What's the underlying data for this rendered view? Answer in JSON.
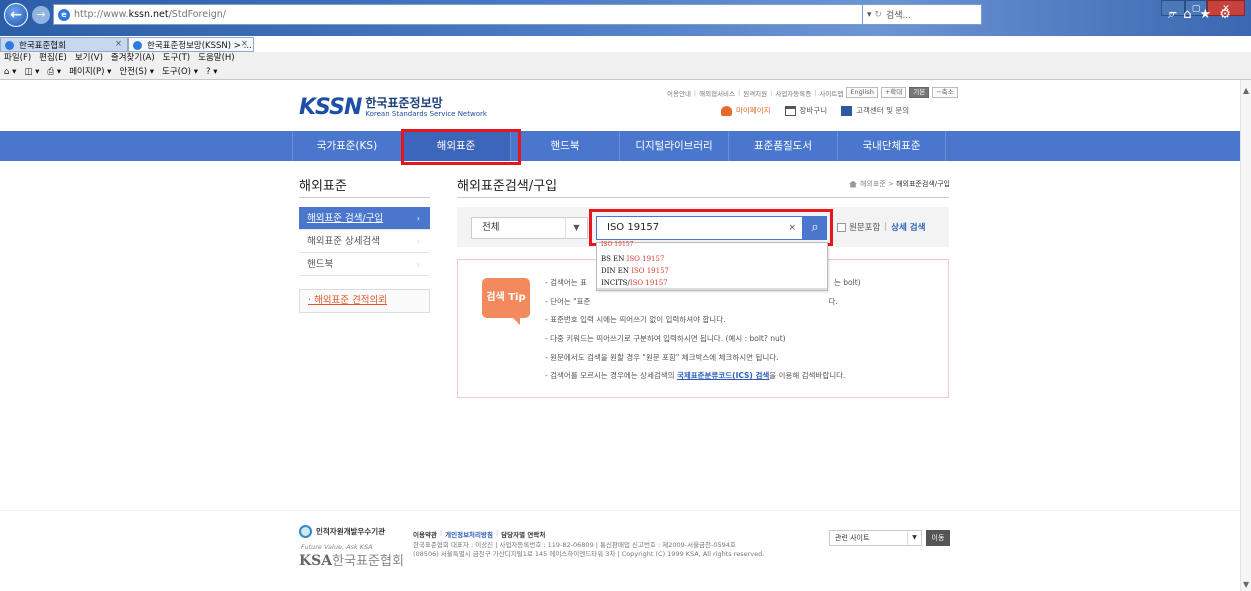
{
  "browser": {
    "url_prefix": "http://www.",
    "url_domain": "kssn.net",
    "url_path": "/StdForeign/",
    "search_placeholder": "검색...",
    "tabs": [
      {
        "title": "한국표준협회"
      },
      {
        "title": "한국표준정보망(KSSN) > ..."
      }
    ],
    "menu": [
      "파일(F)",
      "편집(E)",
      "보기(V)",
      "즐겨찾기(A)",
      "도구(T)",
      "도움말(H)"
    ],
    "commands": [
      "▾",
      "▾",
      "▾",
      "페이지(P) ▾",
      "안전(S) ▾",
      "도구(O) ▾",
      "▾"
    ]
  },
  "site": {
    "logo_mark": "KSSN",
    "logo_ko": "한국표준정보망",
    "logo_en": "Korean Standards Service Network",
    "util_links": [
      "이용안내",
      "해외협서비스",
      "원격지원",
      "사업자등록증",
      "사이트맵"
    ],
    "util_buttons": [
      "English",
      "+확대",
      "기본",
      "−축소"
    ],
    "user_links": {
      "mypage": "마이페이지",
      "cart": "장바구니",
      "support": "고객센터 및 문의"
    },
    "gnb": [
      "국가표준(KS)",
      "해외표준",
      "핸드북",
      "디지털라이브러리",
      "표준품질도서",
      "국내단체표준"
    ]
  },
  "side": {
    "title": "해외표준",
    "items": [
      "해외표준 검색/구입",
      "해외표준 상세검색",
      "핸드북"
    ],
    "box": "· 해외표준 견적의뢰"
  },
  "content": {
    "title": "해외표준검색/구입",
    "breadcrumb": [
      "해외표준",
      "해외표준검색/구입"
    ],
    "select_value": "전체",
    "search_value": "ISO 19157",
    "checkbox_label": "원문포함",
    "detail_search": "상세 검색",
    "suggestions": [
      {
        "prefix": "BS EN ",
        "match": "ISO 19157"
      },
      {
        "prefix": "DIN EN ",
        "match": "ISO 19157"
      },
      {
        "prefix": "INCITS/",
        "match": "ISO 19157"
      }
    ],
    "suggest_hidden": "ISO 19157",
    "tip_badge": "검색 Tip",
    "tips": [
      "- 검색어는 표",
      "- 단어는 \"표준",
      "- 표준번호 입력 시에는 띄어쓰기 없이 입력하셔야 합니다.",
      "- 다중 키워드는 띄어쓰기로 구분하여 입력하시면 됩니다. (예시 : bolt? nut)",
      "- 원문에서도 검색을 원할 경우 \"원문 포함\" 체크박스에 체크하시면 됩니다.",
      "- 검색어를 모르시는 경우에는 상세검색의 "
    ],
    "tip_tail_1": "는 bolt)",
    "tip_tail_2": "다.",
    "tip_link": "국제표준분류코드(ICS) 검색",
    "tip_link_after": "을 이용해 검색바랍니다."
  },
  "footer": {
    "award": "인적자원개발우수기관",
    "slogan": "Future Value, Ask KSA",
    "ksa_en": "KSA",
    "ksa_ko": "한국표준협회",
    "links": [
      "이용약관",
      "개인정보처리방침",
      "담당자별 연락처"
    ],
    "info_line1": "한국표준협회 대표자 : 이상진 | 사업자등록번호 : 119-82-06809 | 통신판매업 신고번호 : 제2009-서울금천-0594호",
    "info_line2": "(08506) 서울특별시 금천구 가산디지털1로 145 에이스하이엔드타워 3차 | Copyright (C) 1999 KSA, All rights reserved.",
    "related_label": "관련 사이트",
    "move_btn": "이동"
  }
}
